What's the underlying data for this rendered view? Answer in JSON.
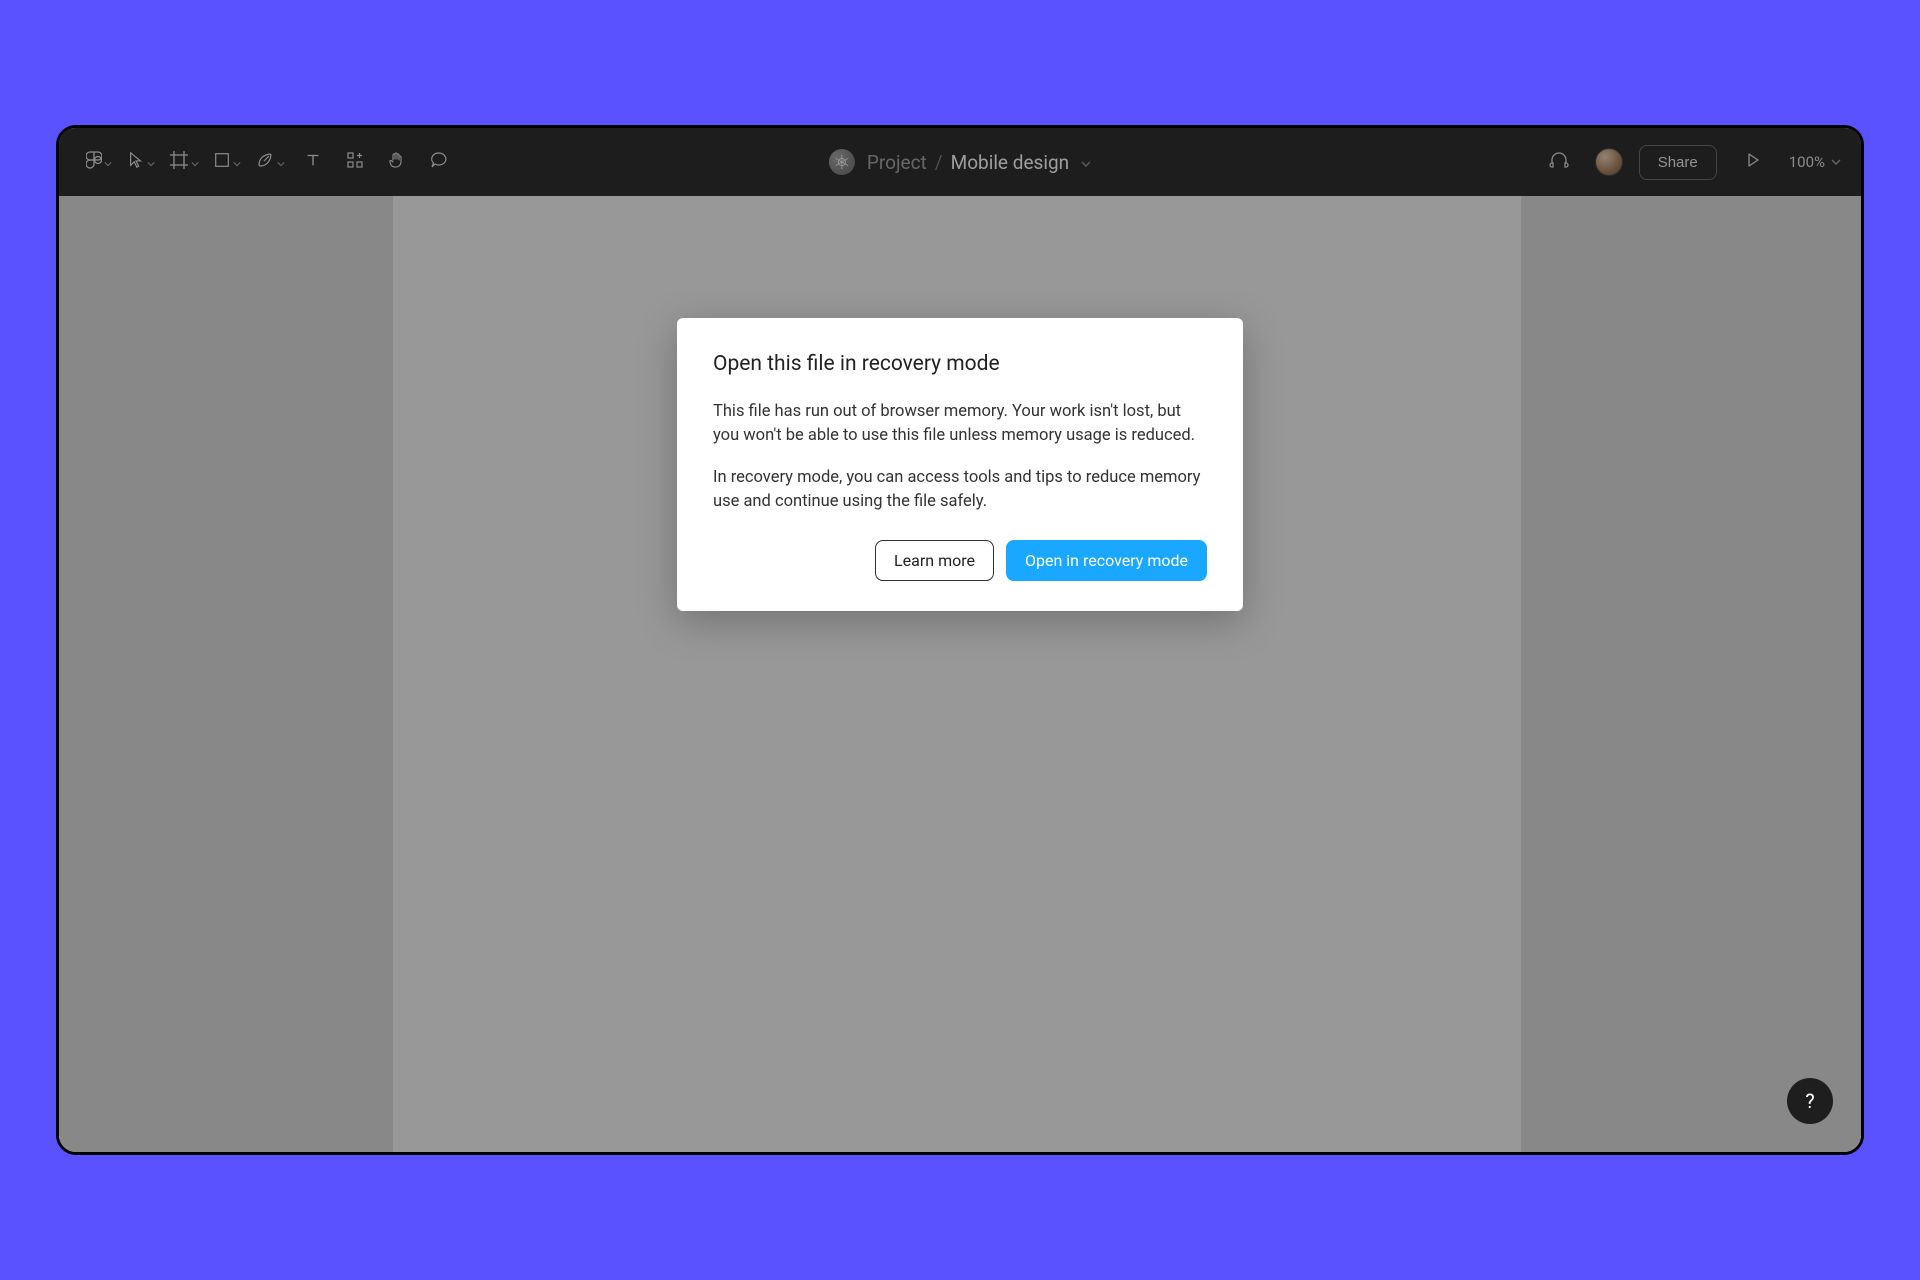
{
  "header": {
    "project_label": "Project",
    "separator": "/",
    "file_name": "Mobile design",
    "share_label": "Share",
    "zoom_label": "100%"
  },
  "modal": {
    "title": "Open this file in recovery mode",
    "paragraph_1": "This file has run out of browser memory. Your work isn't lost, but you won't be able to use this file unless memory usage is reduced.",
    "paragraph_2": "In recovery mode, you can access tools and tips to reduce memory use and continue using the file safely.",
    "learn_more_label": "Learn more",
    "primary_label": "Open in recovery mode"
  },
  "help": {
    "label": "?"
  },
  "colors": {
    "page_bg": "#5a52ff",
    "toolbar_bg": "#2c2c2c",
    "canvas_bg": "#c9c9c9",
    "primary_blue": "#1aa7ff"
  }
}
